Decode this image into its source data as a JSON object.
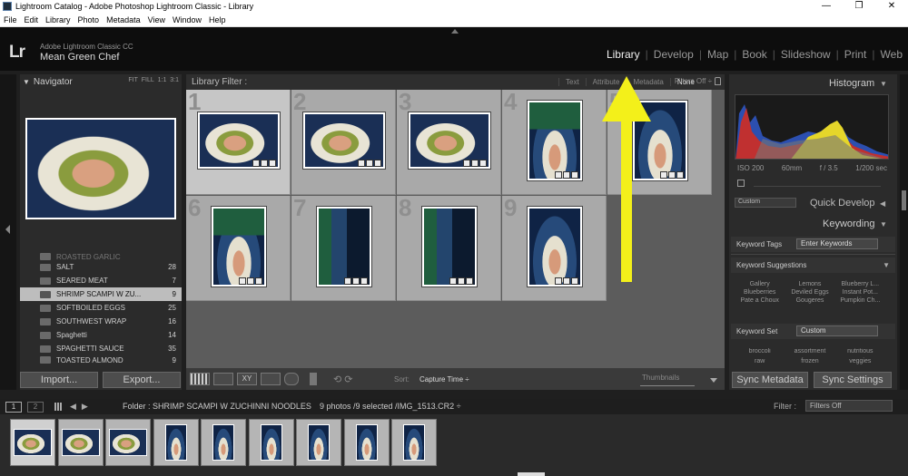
{
  "window": {
    "title": "Lightroom Catalog - Adobe Photoshop Lightroom Classic - Library",
    "controls": [
      "—",
      "❐",
      "✕"
    ]
  },
  "menu": [
    "File",
    "Edit",
    "Library",
    "Photo",
    "Metadata",
    "View",
    "Window",
    "Help"
  ],
  "identity": {
    "logo": "Lr",
    "app_name": "Adobe Lightroom Classic CC",
    "user": "Mean Green Chef"
  },
  "modules": [
    "Library",
    "Develop",
    "Map",
    "Book",
    "Slideshow",
    "Print",
    "Web"
  ],
  "active_module": "Library",
  "navigator": {
    "title": "Navigator",
    "zoom_options": [
      "FIT",
      "FILL",
      "1:1",
      "3:1"
    ]
  },
  "folders": [
    {
      "name": "ROASTED GARLIC",
      "count": ""
    },
    {
      "name": "SALT",
      "count": "28"
    },
    {
      "name": "SEARED MEAT",
      "count": "7"
    },
    {
      "name": "SHRIMP SCAMPI W ZU...",
      "count": "9"
    },
    {
      "name": "SOFTBOILED EGGS",
      "count": "25"
    },
    {
      "name": "SOUTHWEST WRAP",
      "count": "16"
    },
    {
      "name": "Spaghetti",
      "count": "14"
    },
    {
      "name": "SPAGHETTI SAUCE",
      "count": "35"
    },
    {
      "name": "TOASTED ALMOND",
      "count": "9"
    }
  ],
  "left_buttons": {
    "import": "Import...",
    "export": "Export..."
  },
  "library_filter": {
    "label": "Library Filter :",
    "options": [
      "Text",
      "Attribute",
      "Metadata",
      "None"
    ],
    "active": "None",
    "preset": "Filters Off ÷"
  },
  "grid": [
    {
      "num": "1",
      "orientation": "landscape"
    },
    {
      "num": "2",
      "orientation": "landscape"
    },
    {
      "num": "3",
      "orientation": "landscape"
    },
    {
      "num": "4",
      "orientation": "portrait"
    },
    {
      "num": "5",
      "orientation": "portrait"
    },
    {
      "num": "6",
      "orientation": "portrait"
    },
    {
      "num": "7",
      "orientation": "portrait"
    },
    {
      "num": "8",
      "orientation": "portrait"
    },
    {
      "num": "9",
      "orientation": "portrait"
    }
  ],
  "toolbar": {
    "sort_label": "Sort:",
    "sort_value": "Capture Time ÷",
    "thumbnails_label": "Thumbnails"
  },
  "histogram": {
    "title": "Histogram",
    "iso": "ISO 200",
    "focal": "60mm",
    "aperture": "f / 3.5",
    "shutter": "1/200 sec"
  },
  "quick_develop": {
    "preset": "Custom",
    "title": "Quick Develop"
  },
  "keywording": {
    "title": "Keywording",
    "tags_label": "Keyword Tags",
    "tags_value": "Enter Keywords",
    "suggestions_label": "Keyword Suggestions",
    "suggestions": [
      "Gallery",
      "Lemons",
      "Blueberry L...",
      "Blueberries",
      "Deviled Eggs",
      "Instant Pot...",
      "Pate a Choux",
      "Gougeres",
      "Pumpkin Ch..."
    ],
    "set_label": "Keyword Set",
    "set_value": "Custom",
    "set_keywords": [
      "broccoli",
      "assortment",
      "nutritious",
      "raw",
      "frozen",
      "veggies"
    ]
  },
  "right_buttons": {
    "sync_metadata": "Sync Metadata",
    "sync_settings": "Sync Settings"
  },
  "filmstrip": {
    "pages": [
      "1",
      "2"
    ],
    "folder": "Folder : SHRIMP SCAMPI W ZUCHINNI NOODLES",
    "count": "9 photos /9 selected /IMG_1513.CR2 ÷",
    "filter_label": "Filter :",
    "filter_value": "Filters Off"
  }
}
